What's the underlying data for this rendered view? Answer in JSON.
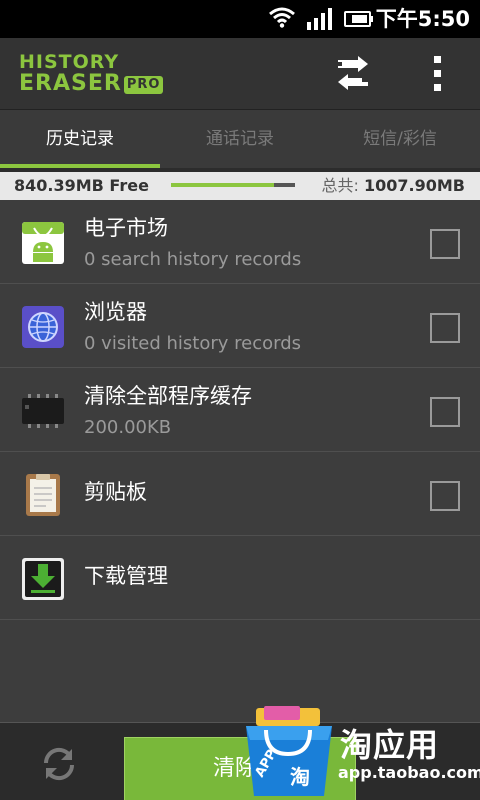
{
  "status_bar": {
    "time": "下午5:50",
    "icons": [
      "wifi-icon",
      "signal-icon",
      "battery-icon"
    ]
  },
  "header": {
    "logo_line1": "HISTORY",
    "logo_line2": "ERASER",
    "logo_badge": "PRO",
    "actions": [
      "swap-icon",
      "overflow-menu-icon"
    ]
  },
  "tabs": [
    {
      "label": "历史记录",
      "active": true
    },
    {
      "label": "通话记录",
      "active": false
    },
    {
      "label": "短信/彩信",
      "active": false
    }
  ],
  "storage": {
    "free": "840.39MB Free",
    "total_label": "总共:",
    "total_value": "1007.90MB",
    "used_fraction": 0.83
  },
  "items": [
    {
      "icon": "android-market-icon",
      "title": "电子市场",
      "subtitle": "0 search history records",
      "has_checkbox": true,
      "checked": false
    },
    {
      "icon": "browser-globe-icon",
      "title": "浏览器",
      "subtitle": "0 visited history records",
      "has_checkbox": true,
      "checked": false
    },
    {
      "icon": "memory-chip-icon",
      "title": "清除全部程序缓存",
      "subtitle": "200.00KB",
      "has_checkbox": true,
      "checked": false
    },
    {
      "icon": "clipboard-icon",
      "title": "剪贴板",
      "subtitle": "",
      "has_checkbox": true,
      "checked": false
    },
    {
      "icon": "download-icon",
      "title": "下载管理",
      "subtitle": "",
      "has_checkbox": false,
      "checked": false
    }
  ],
  "bottom": {
    "clear_label": "清除选中",
    "refresh_icon": "refresh-icon"
  },
  "watermark": {
    "text": "淘应用",
    "url": "app.taobao.com",
    "bag_label": "APP",
    "bag_char": "淘"
  },
  "colors": {
    "accent": "#8cc63f",
    "background": "#3d3d3d",
    "watermark_blue": "#1a7fd8"
  }
}
